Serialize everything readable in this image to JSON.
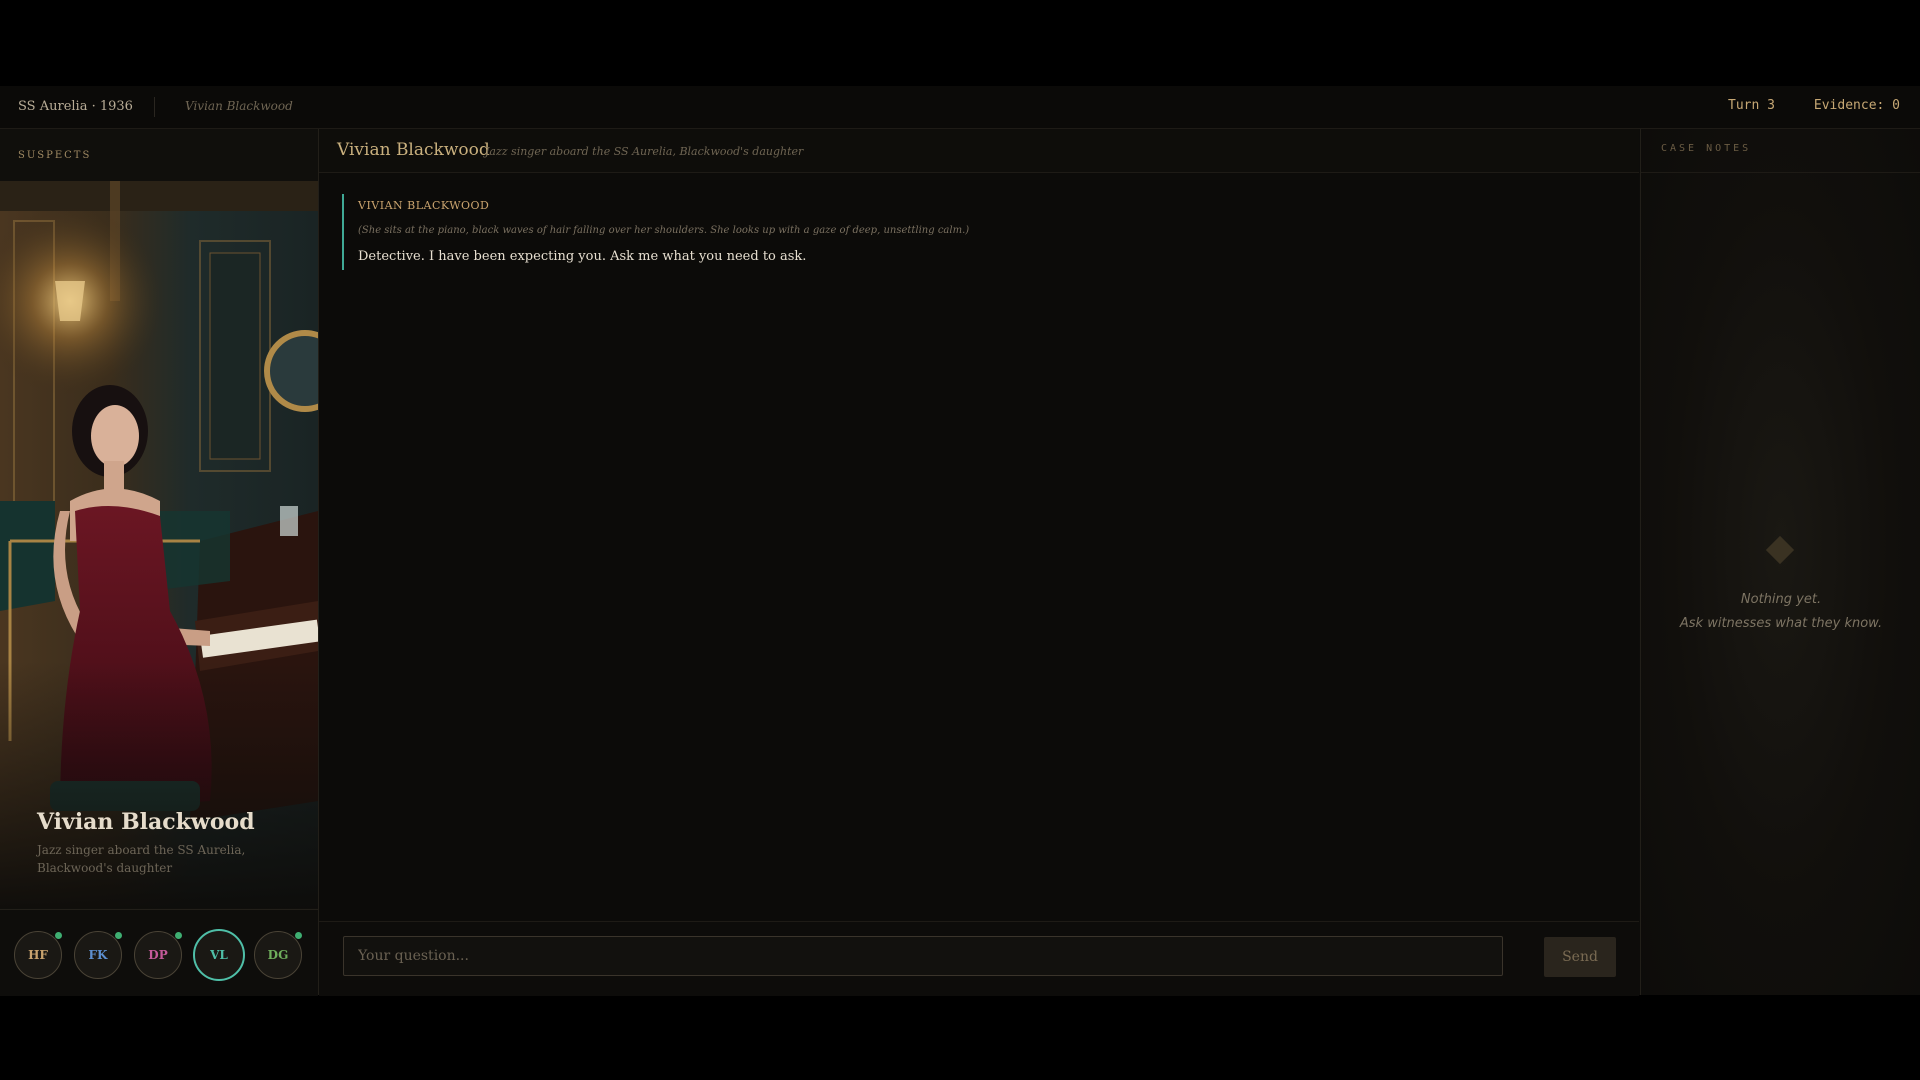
{
  "topbar": {
    "title": "SS Aurelia · 1936",
    "current_suspect": "Vivian Blackwood",
    "turn": "Turn 3",
    "evidence": "Evidence: 0"
  },
  "sidebar": {
    "header": "SUSPECTS",
    "portrait": {
      "name": "Vivian Blackwood",
      "description": "Jazz singer aboard the SS Aurelia, Blackwood's daughter"
    },
    "suspects": [
      {
        "initials": "HF",
        "color": "#c9a36e",
        "has_new": true,
        "active": false
      },
      {
        "initials": "FK",
        "color": "#5d8fd0",
        "has_new": true,
        "active": false
      },
      {
        "initials": "DP",
        "color": "#c45a9a",
        "has_new": true,
        "active": false
      },
      {
        "initials": "VL",
        "color": "#4fbfa8",
        "has_new": false,
        "active": true
      },
      {
        "initials": "DG",
        "color": "#6fae5c",
        "has_new": true,
        "active": false
      }
    ]
  },
  "main": {
    "header_name": "Vivian Blackwood",
    "header_desc": "Jazz singer aboard the SS Aurelia, Blackwood's daughter",
    "message": {
      "speaker": "VIVIAN BLACKWOOD",
      "action": "(She sits at the piano, black waves of hair falling over her shoulders. She looks up with a gaze of deep, unsettling calm.)",
      "text": "Detective. I have been expecting you. Ask me what you need to ask."
    },
    "input": {
      "placeholder": "Your question...",
      "value": ""
    },
    "send_label": "Send"
  },
  "notes": {
    "header": "CASE NOTES",
    "empty_line1": "Nothing yet.",
    "empty_line2": "Ask witnesses what they know."
  },
  "colors": {
    "accent_gold": "#c9a36e",
    "accent_teal": "#4fbfa8",
    "new_dot": "#3fae72"
  }
}
